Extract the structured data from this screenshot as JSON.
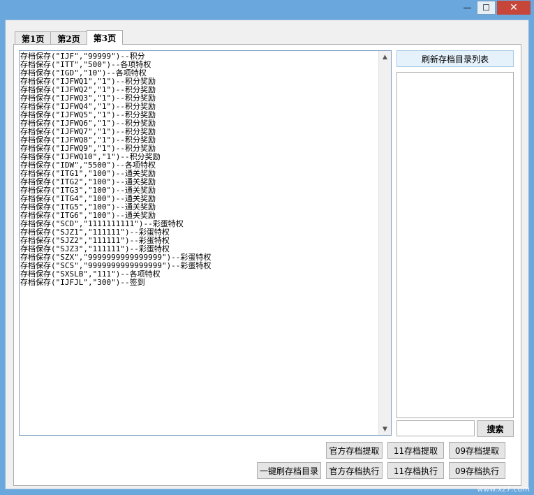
{
  "window": {
    "controls": {
      "minimize": "—",
      "maximize": "☐",
      "close": "✕"
    }
  },
  "tabs": [
    "第1页",
    "第2页",
    "第3页"
  ],
  "active_tab": 2,
  "editor": {
    "lines": [
      "存档保存(\"IJF\",\"99999\")--积分",
      "存档保存(\"ITT\",\"500\")--各项特权",
      "存档保存(\"IGD\",\"10\")--各项特权",
      "存档保存(\"IJFWQ1\",\"1\")--积分奖励",
      "存档保存(\"IJFWQ2\",\"1\")--积分奖励",
      "存档保存(\"IJFWQ3\",\"1\")--积分奖励",
      "存档保存(\"IJFWQ4\",\"1\")--积分奖励",
      "存档保存(\"IJFWQ5\",\"1\")--积分奖励",
      "存档保存(\"IJFWQ6\",\"1\")--积分奖励",
      "存档保存(\"IJFWQ7\",\"1\")--积分奖励",
      "存档保存(\"IJFWQ8\",\"1\")--积分奖励",
      "存档保存(\"IJFWQ9\",\"1\")--积分奖励",
      "存档保存(\"IJFWQ10\",\"1\")--积分奖励",
      "存档保存(\"IDW\",\"5500\")--各项特权",
      "存档保存(\"ITG1\",\"100\")--通关奖励",
      "存档保存(\"ITG2\",\"100\")--通关奖励",
      "存档保存(\"ITG3\",\"100\")--通关奖励",
      "存档保存(\"ITG4\",\"100\")--通关奖励",
      "存档保存(\"ITG5\",\"100\")--通关奖励",
      "存档保存(\"ITG6\",\"100\")--通关奖励",
      "存档保存(\"SCD\",\"1111111111\")--彩蛋特权",
      "存档保存(\"SJZ1\",\"111111\")--彩蛋特权",
      "存档保存(\"SJZ2\",\"111111\")--彩蛋特权",
      "存档保存(\"SJZ3\",\"111111\")--彩蛋特权",
      "存档保存(\"SZX\",\"9999999999999999\")--彩蛋特权",
      "存档保存(\"SCS\",\"9999999999999999\")--彩蛋特权",
      "存档保存(\"SXSLB\",\"111\")--各项特权",
      "存档保存(\"IJFJL\",\"300\")--签到"
    ]
  },
  "right_panel": {
    "refresh_button": "刷新存档目录列表",
    "search_placeholder": "",
    "search_button": "搜索"
  },
  "buttons": {
    "official_extract": "官方存档提取",
    "extract_11": "11存档提取",
    "extract_09": "09存档提取",
    "refresh_all": "一键刷存档目录",
    "official_exec": "官方存档执行",
    "exec_11": "11存档执行",
    "exec_09": "09存档执行"
  },
  "watermark": "www.xz7.com"
}
